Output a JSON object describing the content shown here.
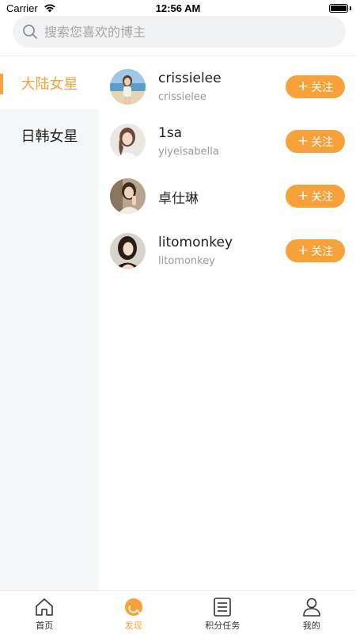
{
  "status_bar": {
    "carrier": "Carrier",
    "time": "12:56 AM"
  },
  "search": {
    "placeholder": "搜索您喜欢的博主",
    "icon": "search-icon"
  },
  "categories": [
    {
      "label": "大陆女星",
      "active": true
    },
    {
      "label": "日韩女星",
      "active": false
    }
  ],
  "bloggers": [
    {
      "name": "crissielee",
      "handle": "crissielee",
      "avatar": "beach-photo",
      "follow_label": "关注"
    },
    {
      "name": "1sa",
      "handle": "yiyeisabella",
      "avatar": "portrait-photo",
      "follow_label": "关注"
    },
    {
      "name": "卓仕琳",
      "handle": "",
      "avatar": "portrait-photo",
      "follow_label": "关注"
    },
    {
      "name": "litomonkey",
      "handle": "litomonkey",
      "avatar": "portrait-photo",
      "follow_label": "关注"
    }
  ],
  "tab_bar": {
    "tabs": [
      {
        "label": "首页",
        "icon": "home-icon",
        "active": false
      },
      {
        "label": "发现",
        "icon": "discover-icon",
        "active": true
      },
      {
        "label": "积分任务",
        "icon": "task-list-icon",
        "active": false
      },
      {
        "label": "我的",
        "icon": "profile-icon",
        "active": false
      }
    ]
  },
  "colors": {
    "accent": "#f7a13a",
    "panel_bg": "#f5f6f8",
    "search_bg": "#f1f2f4"
  }
}
